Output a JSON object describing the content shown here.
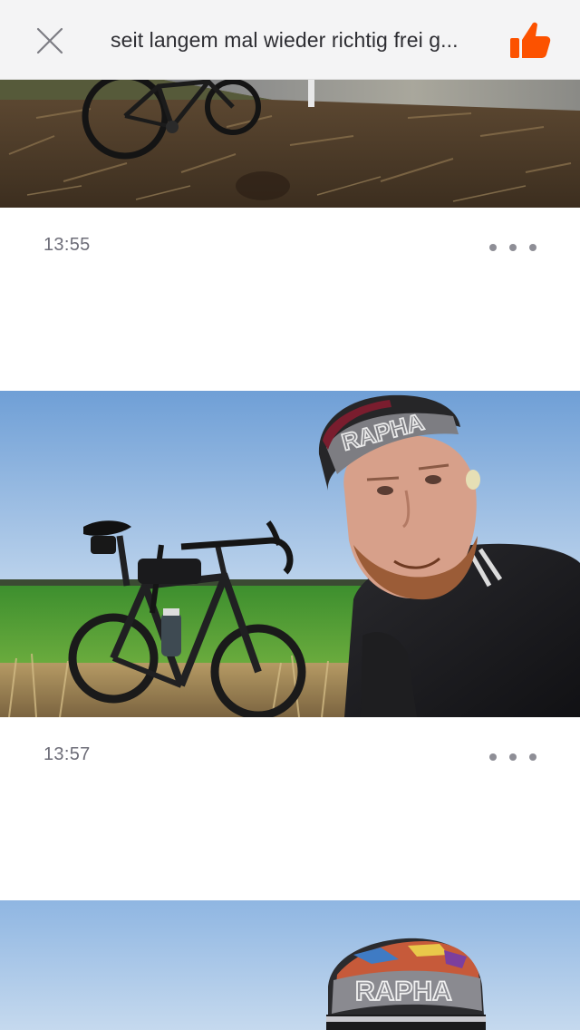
{
  "header": {
    "title": "seit langem mal wieder richtig frei g...",
    "close_icon": "close-icon",
    "like_icon": "thumbs-up-icon",
    "accent_color": "#fc5200"
  },
  "feed": {
    "entries": [
      {
        "time": "13:55",
        "more_icon": "more-horizontal-icon",
        "photo": "bike-in-dry-grass"
      },
      {
        "time": "13:57",
        "more_icon": "more-horizontal-icon",
        "photo": "selfie-with-gravel-bike",
        "cap_text": "RAPHA"
      },
      {
        "photo": "selfie-with-cap",
        "cap_text": "RAPHA"
      }
    ]
  }
}
